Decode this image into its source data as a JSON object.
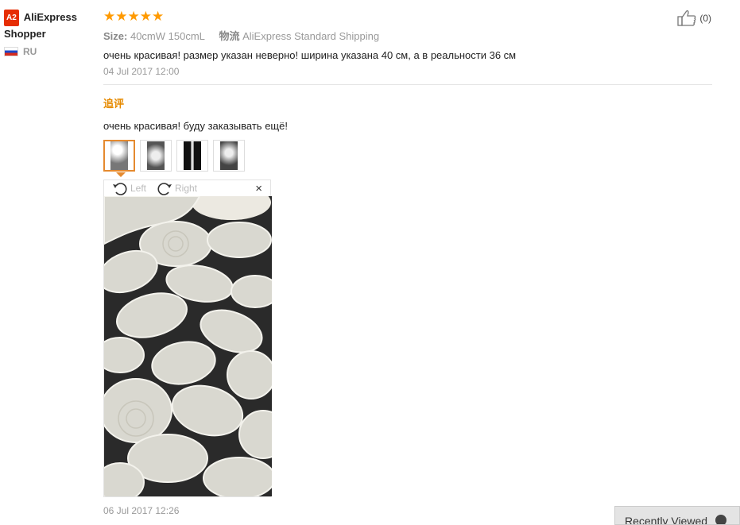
{
  "user": {
    "badge": "A2",
    "name": "AliExpress Shopper",
    "country": "RU"
  },
  "review": {
    "stars": "★★★★★",
    "size_label": "Size:",
    "size_value": "40cmW 150cmL",
    "logistics_label": "物流",
    "logistics_value": "AliExpress Standard Shipping",
    "text": "очень красивая! размер указан неверно! ширина указана 40 см, а в реальности 36 см",
    "date": "04 Jul 2017 12:00",
    "helpful_count": "(0)"
  },
  "additional": {
    "label": "追评",
    "text": "очень красивая! буду заказывать ещё!",
    "date": "06 Jul 2017 12:26"
  },
  "viewer": {
    "left_label": "Left",
    "right_label": "Right",
    "close_symbol": "×"
  },
  "recently_viewed": {
    "label": "Recently Viewed"
  },
  "colors": {
    "star": "#ff9a00",
    "additional_label": "#e68a00",
    "active_thumb": "#e58a2f"
  }
}
